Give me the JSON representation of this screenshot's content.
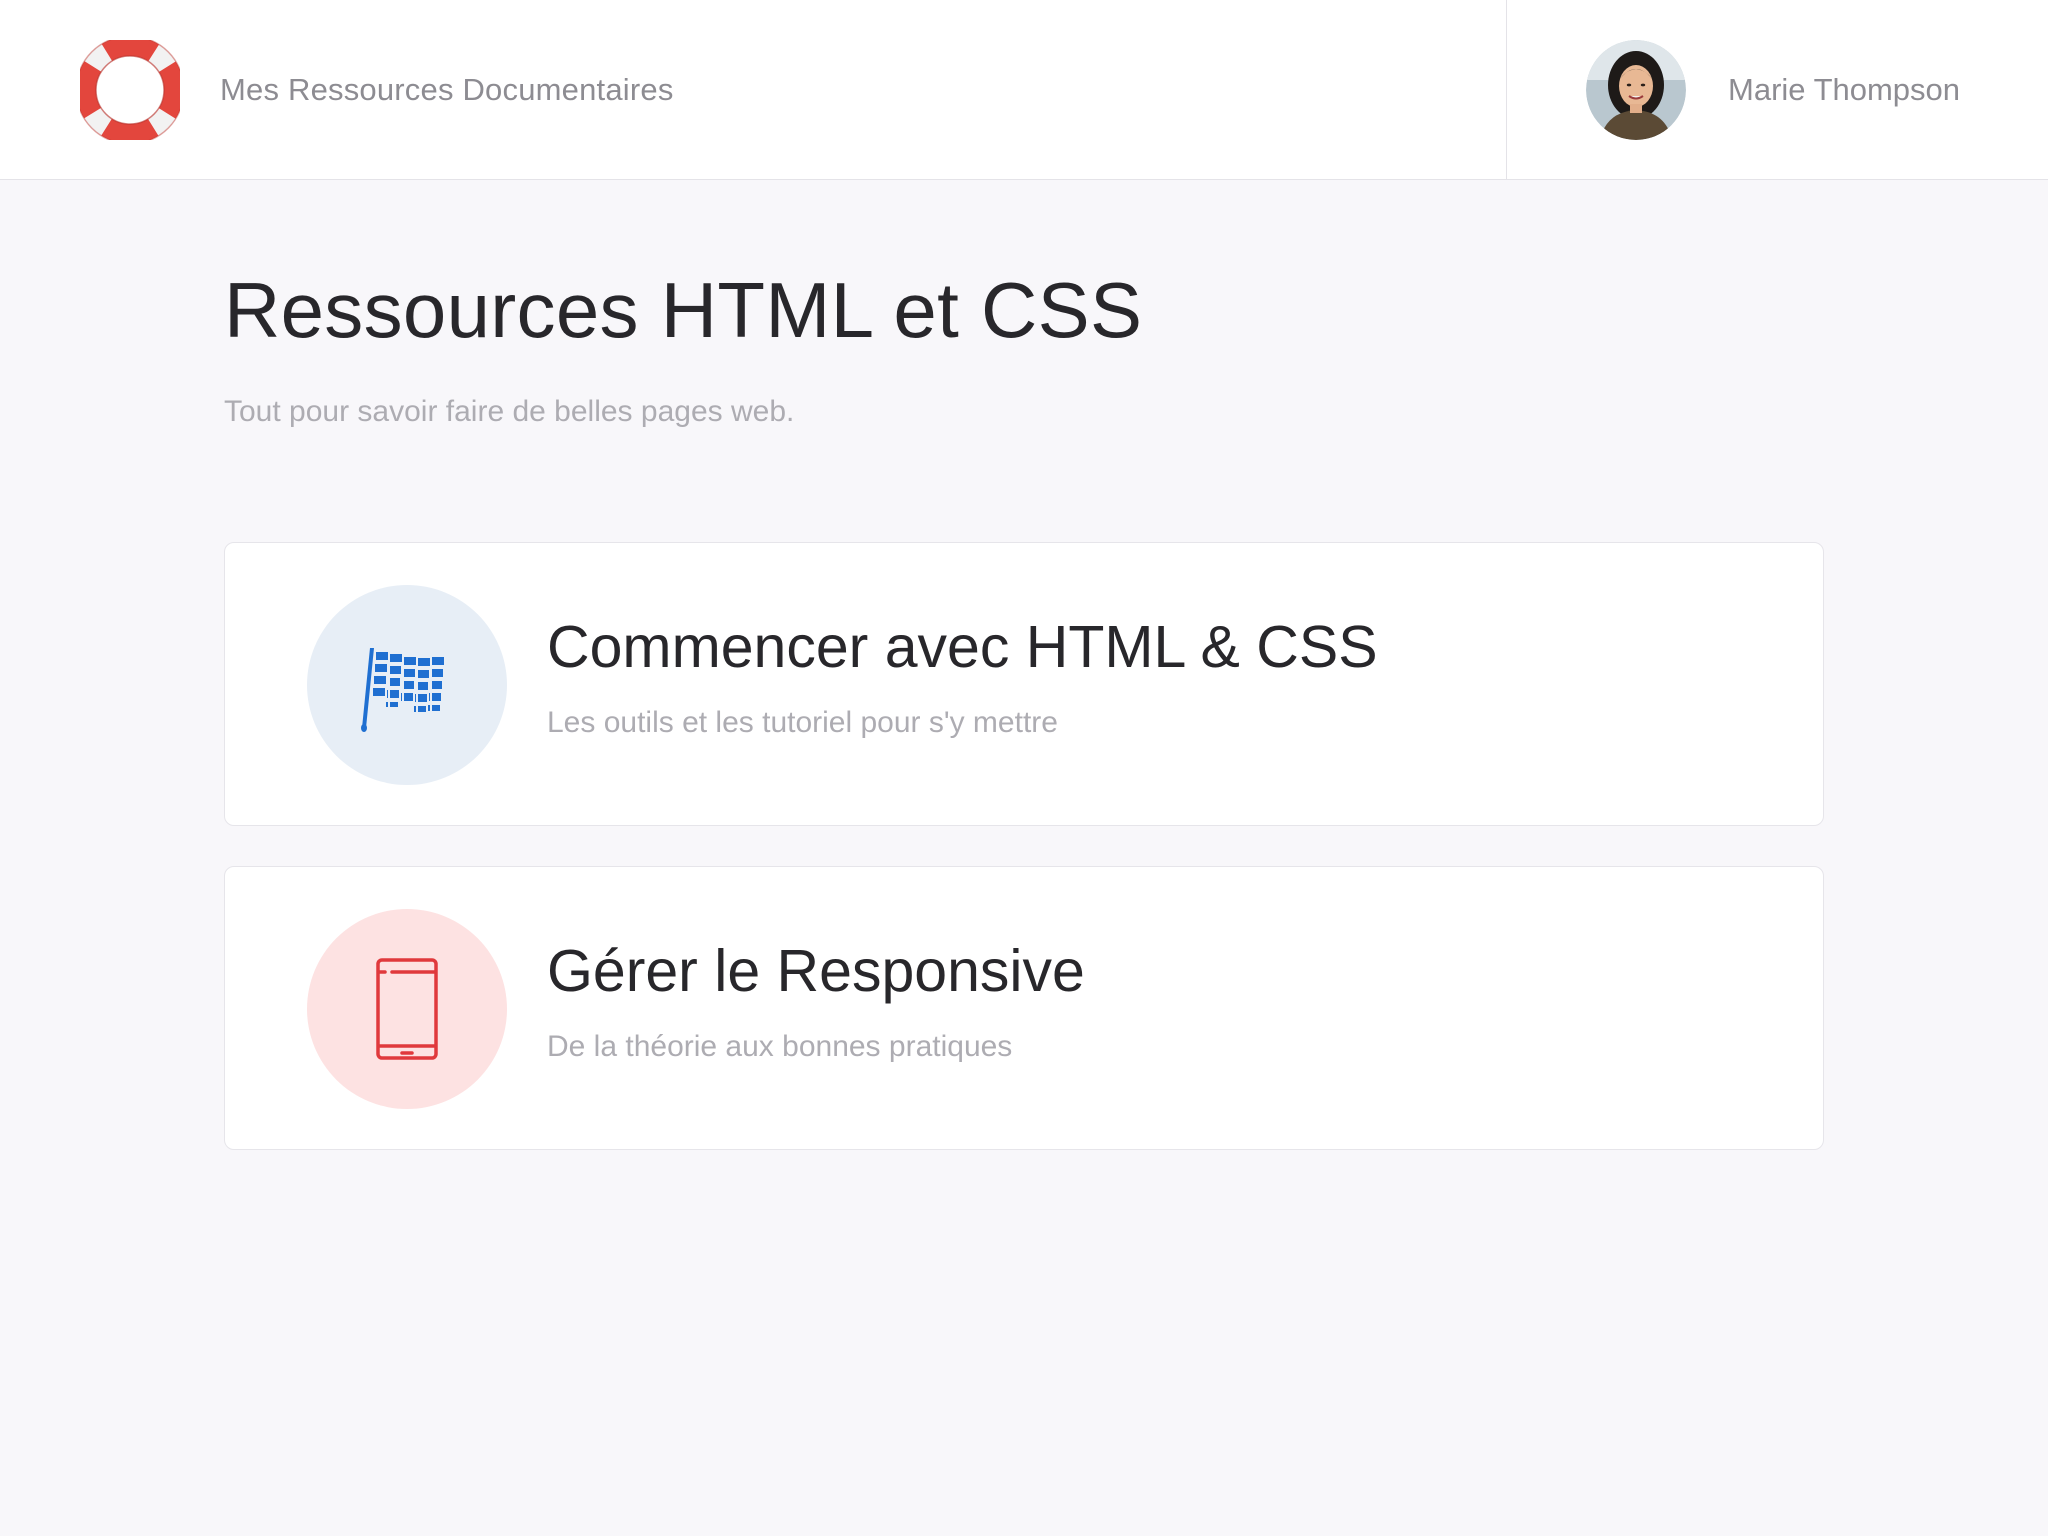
{
  "header": {
    "app_title": "Mes Ressources Documentaires",
    "logo_icon": "lifebuoy-icon",
    "user": {
      "name": "Marie Thompson",
      "avatar_icon": "user-avatar"
    }
  },
  "page": {
    "title": "Ressources HTML et CSS",
    "subtitle": "Tout pour savoir faire de belles pages web."
  },
  "cards": [
    {
      "title": "Commencer avec HTML & CSS",
      "subtitle": "Les outils et les tutoriel pour s'y mettre",
      "icon": "checkered-flag-icon",
      "icon_color": "#1f6fd1",
      "icon_bg": "#e7eef6"
    },
    {
      "title": "Gérer le Responsive",
      "subtitle": "De la théorie aux bonnes pratiques",
      "icon": "mobile-phone-icon",
      "icon_color": "#e0393c",
      "icon_bg": "#fde2e2"
    }
  ],
  "colors": {
    "accent_red": "#e3463d",
    "text_dark": "#28272b",
    "text_muted": "#adacb2",
    "background": "#f8f7fa"
  }
}
